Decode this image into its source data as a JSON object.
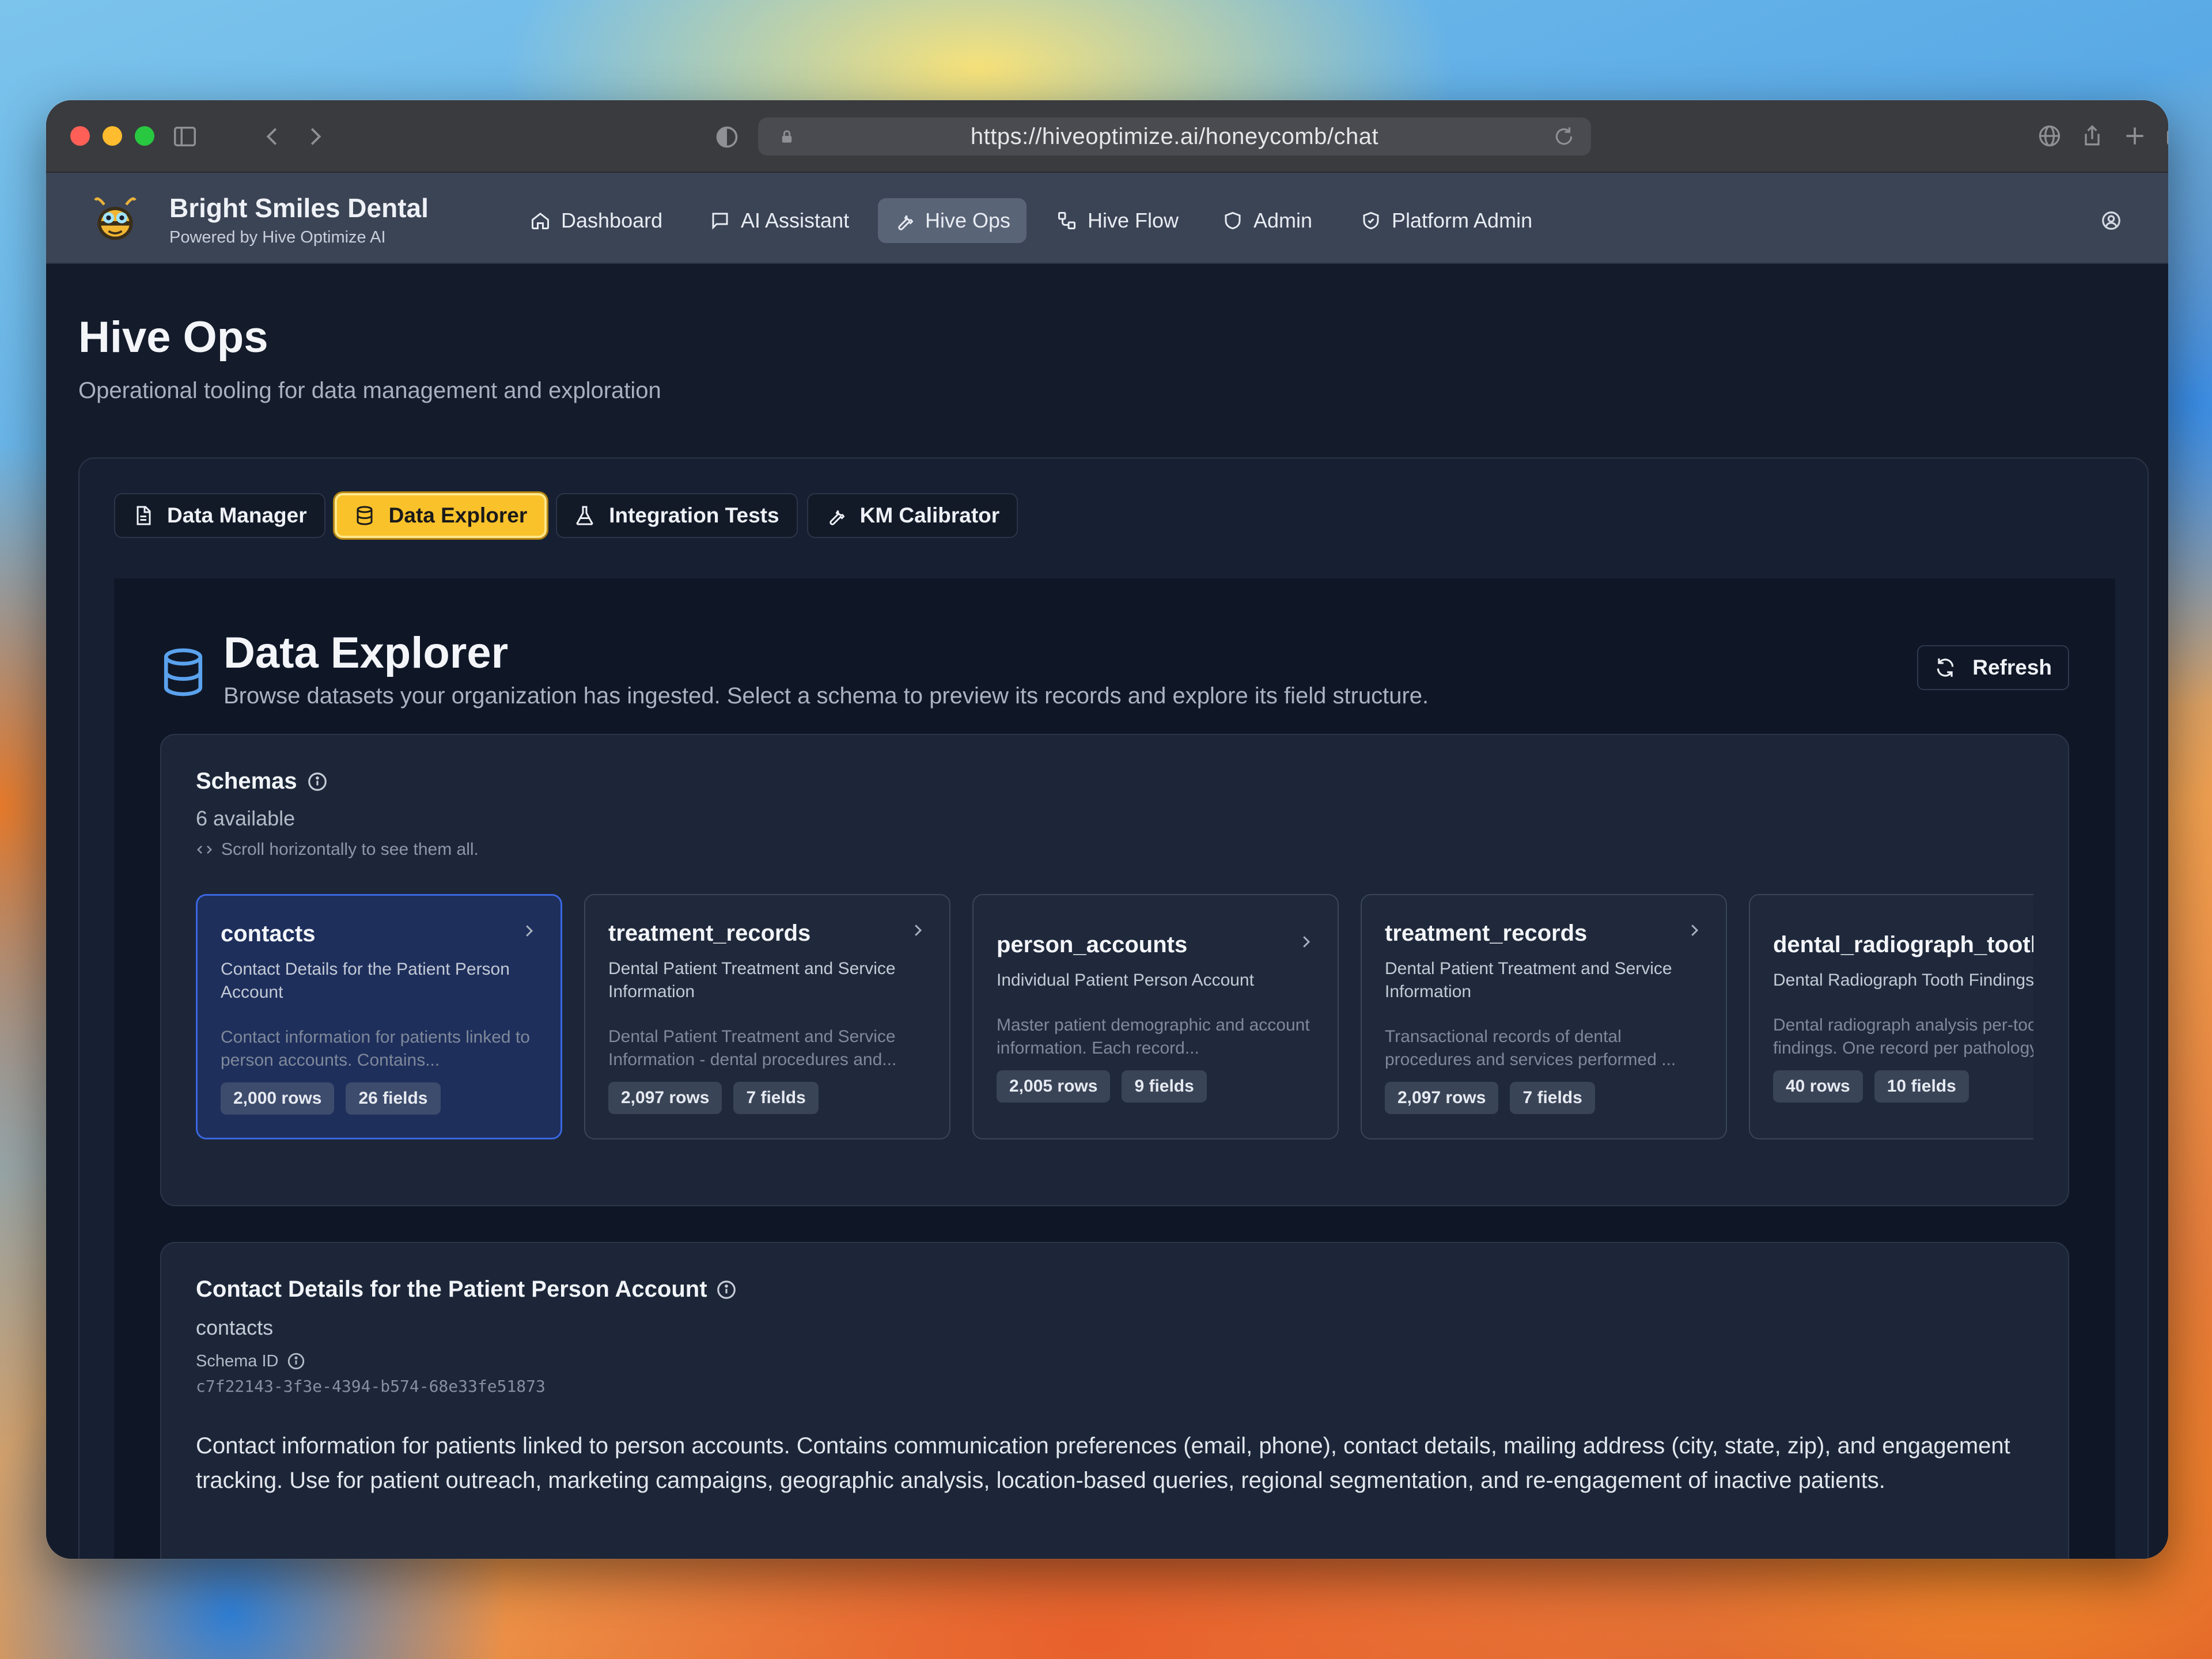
{
  "browser": {
    "url": "https://hiveoptimize.ai/honeycomb/chat"
  },
  "brand": {
    "name": "Bright Smiles Dental",
    "tagline": "Powered by Hive Optimize AI"
  },
  "nav": {
    "items": [
      {
        "label": "Dashboard",
        "icon": "home-icon"
      },
      {
        "label": "AI Assistant",
        "icon": "chat-icon"
      },
      {
        "label": "Hive Ops",
        "icon": "wrench-icon",
        "active": true
      },
      {
        "label": "Hive Flow",
        "icon": "workflow-icon"
      },
      {
        "label": "Admin",
        "icon": "shield-icon"
      },
      {
        "label": "Platform Admin",
        "icon": "shield-check-icon"
      }
    ]
  },
  "page": {
    "title": "Hive Ops",
    "subtitle": "Operational tooling for data management and exploration"
  },
  "tabs": [
    {
      "label": "Data Manager",
      "icon": "file-icon"
    },
    {
      "label": "Data Explorer",
      "icon": "database-icon",
      "active": true
    },
    {
      "label": "Integration Tests",
      "icon": "flask-icon"
    },
    {
      "label": "KM Calibrator",
      "icon": "wrench-icon"
    }
  ],
  "explorer": {
    "title": "Data Explorer",
    "subtitle": "Browse datasets your organization has ingested. Select a schema to preview its records and explore its field structure.",
    "refresh_label": "Refresh"
  },
  "schemas": {
    "title": "Schemas",
    "count": "6 available",
    "hint": "Scroll horizontally to see them all.",
    "cards": [
      {
        "name": "contacts",
        "label": "Contact Details for the Patient Person Account",
        "desc": "Contact information for patients linked to person accounts. Contains...",
        "rows": "2,000 rows",
        "fields": "26 fields",
        "selected": true
      },
      {
        "name": "treatment_records",
        "label": "Dental Patient Treatment and Service Information",
        "desc": "Dental Patient Treatment and Service Information - dental procedures and...",
        "rows": "2,097 rows",
        "fields": "7 fields"
      },
      {
        "name": "person_accounts",
        "label": "Individual Patient Person Account",
        "desc": "Master patient demographic and account information. Each record...",
        "rows": "2,005 rows",
        "fields": "9 fields"
      },
      {
        "name": "treatment_records",
        "label": "Dental Patient Treatment and Service Information",
        "desc": "Transactional records of dental procedures and services performed ...",
        "rows": "2,097 rows",
        "fields": "7 fields"
      },
      {
        "name": "dental_radiograph_tooth_findings",
        "label": "Dental Radiograph Tooth Findings",
        "desc": "Dental radiograph analysis per-tooth findings. One record per pathology",
        "rows": "40 rows",
        "fields": "10 fields"
      }
    ]
  },
  "detail": {
    "title": "Contact Details for the Patient Person Account",
    "name": "contacts",
    "schema_id_label": "Schema ID",
    "schema_id": "c7f22143-3f3e-4394-b574-68e33fe51873",
    "description": "Contact information for patients linked to person accounts. Contains communication preferences (email, phone), contact details, mailing address (city, state, zip), and engagement tracking. Use for patient outreach, marketing campaigns, geographic analysis, location-based queries, regional segmentation, and re-engagement of inactive patients."
  }
}
